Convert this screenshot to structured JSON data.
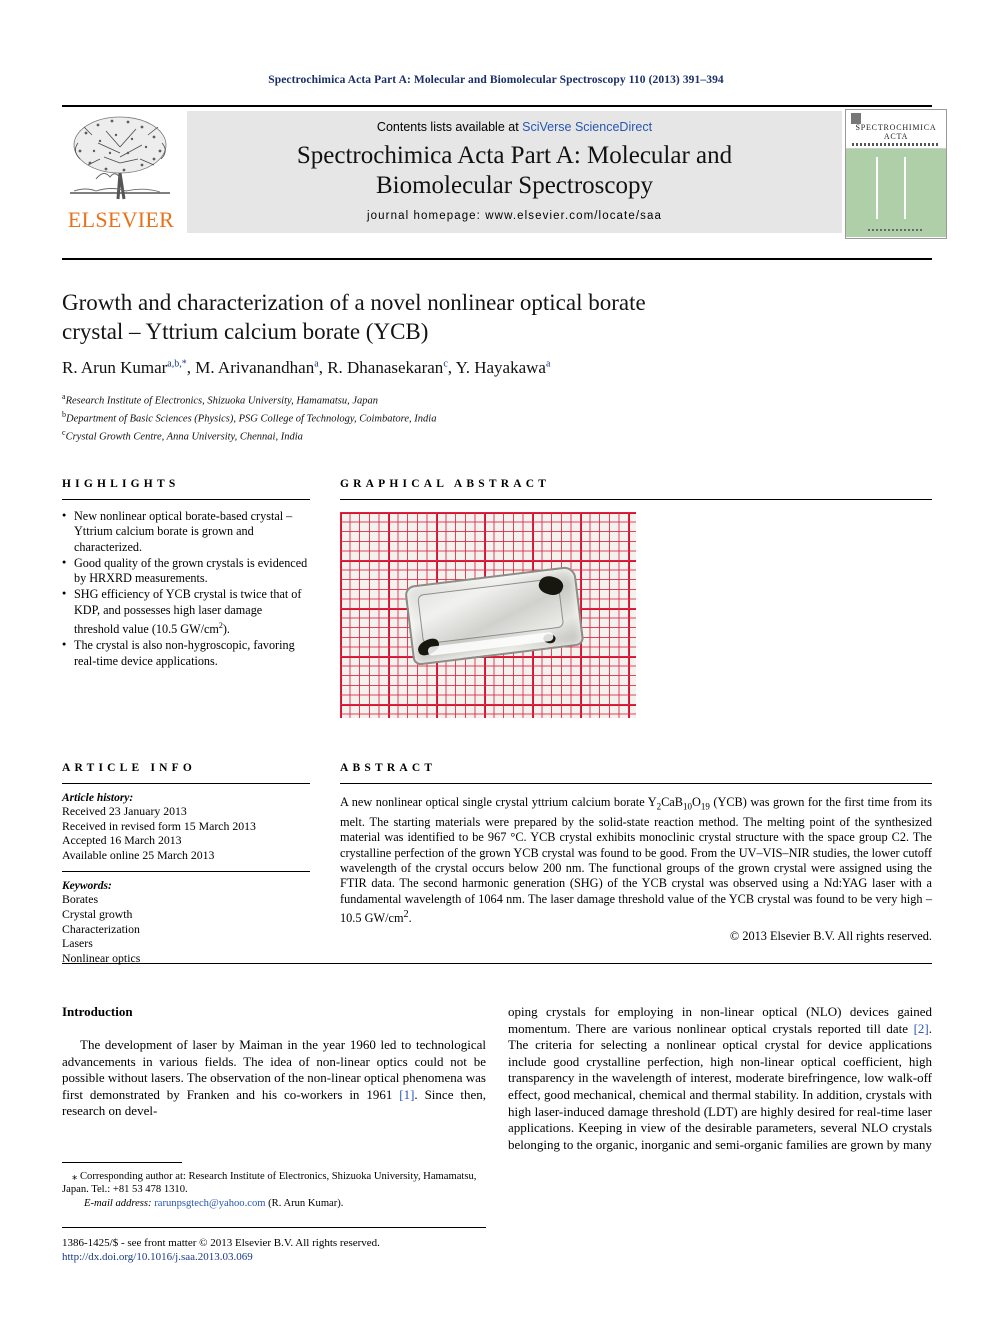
{
  "running_head": "Spectrochimica Acta Part A: Molecular and Biomolecular Spectroscopy 110 (2013) 391–394",
  "masthead": {
    "publisher_name": "ELSEVIER",
    "contents_prefix": "Contents lists available at ",
    "contents_link": "SciVerse ScienceDirect",
    "journal_title_line1": "Spectrochimica Acta Part A: Molecular and",
    "journal_title_line2": "Biomolecular Spectroscopy",
    "journal_homepage": "journal homepage: www.elsevier.com/locate/saa",
    "cover_title_line1": "SPECTROCHIMICA",
    "cover_title_line2": "ACTA"
  },
  "article": {
    "title_line1": "Growth and characterization of a novel nonlinear optical borate",
    "title_line2": "crystal – Yttrium calcium borate (YCB)",
    "authors": [
      {
        "name": "R. Arun Kumar",
        "sup": "a,b,*",
        "sep": ", "
      },
      {
        "name": "M. Arivanandhan",
        "sup": "a",
        "sep": ", "
      },
      {
        "name": "R. Dhanasekaran",
        "sup": "c",
        "sep": ", "
      },
      {
        "name": "Y. Hayakawa",
        "sup": "a",
        "sep": ""
      }
    ],
    "affiliations": [
      {
        "marker": "a",
        "text": "Research Institute of Electronics, Shizuoka University, Hamamatsu, Japan"
      },
      {
        "marker": "b",
        "text": "Department of Basic Sciences (Physics), PSG College of Technology, Coimbatore, India"
      },
      {
        "marker": "c",
        "text": "Crystal Growth Centre, Anna University, Chennai, India"
      }
    ]
  },
  "highlights": {
    "heading": "HIGHLIGHTS",
    "items": [
      "New nonlinear optical borate-based crystal – Yttrium calcium borate is grown and characterized.",
      "Good quality of the grown crystals is evidenced by HRXRD measurements.",
      "SHG efficiency of YCB crystal is twice that of KDP, and possesses high laser damage threshold value (10.5 GW/cm2).",
      "The crystal is also non-hygroscopic, favoring real-time device applications."
    ]
  },
  "graphical_abstract": {
    "heading": "GRAPHICAL ABSTRACT",
    "figure_description": "Photograph of a transparent colorless YCB crystal plate resting on red millimeter graph paper"
  },
  "article_info": {
    "heading": "ARTICLE INFO",
    "history_label": "Article history:",
    "history": [
      "Received 23 January 2013",
      "Received in revised form 15 March 2013",
      "Accepted 16 March 2013",
      "Available online 25 March 2013"
    ],
    "keywords_label": "Keywords:",
    "keywords": [
      "Borates",
      "Crystal growth",
      "Characterization",
      "Lasers",
      "Nonlinear optics"
    ]
  },
  "abstract": {
    "heading": "ABSTRACT",
    "text_part1": "A new nonlinear optical single crystal yttrium calcium borate Y",
    "formula_1_sub": "2",
    "formula_2": "CaB",
    "formula_2_sub": "10",
    "formula_3": "O",
    "formula_3_sub": "19",
    "text_part2": " (YCB) was grown for the first time from its melt. The starting materials were prepared by the solid-state reaction method. The melting point of the synthesized material was identified to be 967 °C. YCB crystal exhibits monoclinic crystal structure with the space group C2. The crystalline perfection of the grown YCB crystal was found to be good. From the UV–VIS–NIR studies, the lower cutoff wavelength of the crystal occurs below 200 nm. The functional groups of the grown crystal were assigned using the FTIR data. The second harmonic generation (SHG) of the YCB crystal was observed using a Nd:YAG laser with a fundamental wavelength of 1064 nm. The laser damage threshold value of the YCB crystal was found to be very high – 10.5 GW/cm",
    "text_superscript": "2",
    "text_part3": ".",
    "copyright": "© 2013 Elsevier B.V. All rights reserved."
  },
  "body": {
    "section_heading": "Introduction",
    "left_paragraph_pre": "The development of laser by Maiman in the year 1960 led to technological advancements in various fields. The idea of non-linear optics could not be possible without lasers. The observation of the non-linear optical phenomena was first demonstrated by Franken and his co-workers in 1961 ",
    "left_ref": "[1]",
    "left_paragraph_post": ". Since then, research on devel-",
    "right_paragraph_pre": "oping crystals for employing in non-linear optical (NLO) devices gained momentum. There are various nonlinear optical crystals reported till date ",
    "right_ref": "[2]",
    "right_paragraph_post": ". The criteria for selecting a nonlinear optical crystal for device applications include good crystalline perfection, high non-linear optical coefficient, high transparency in the wavelength of interest, moderate birefringence, low walk-off effect, good mechanical, chemical and thermal stability. In addition, crystals with high laser-induced damage threshold (LDT) are highly desired for real-time laser applications. Keeping in view of the desirable parameters, several NLO crystals belonging to the organic, inorganic and semi-organic families are grown by many"
  },
  "footnote": {
    "corresponding_symbol": "⁎",
    "corresponding_text": "Corresponding author at: Research Institute of Electronics, Shizuoka University, Hamamatsu, Japan. Tel.: +81 53 478 1310.",
    "email_label": "E-mail address:",
    "email": "rarunpsgtech@yahoo.com",
    "email_owner": "(R. Arun Kumar)."
  },
  "imprint": {
    "issn_line": "1386-1425/$ - see front matter © 2013 Elsevier B.V. All rights reserved.",
    "doi": "http://dx.doi.org/10.1016/j.saa.2013.03.069"
  },
  "colors": {
    "link_blue": "#2756b0",
    "running_head_navy": "#1a2f66",
    "elsevier_orange": "#E9711C",
    "band_grey": "#e6e6e6",
    "cover_green": "#aecfa7",
    "grid_red": "#d01432"
  }
}
